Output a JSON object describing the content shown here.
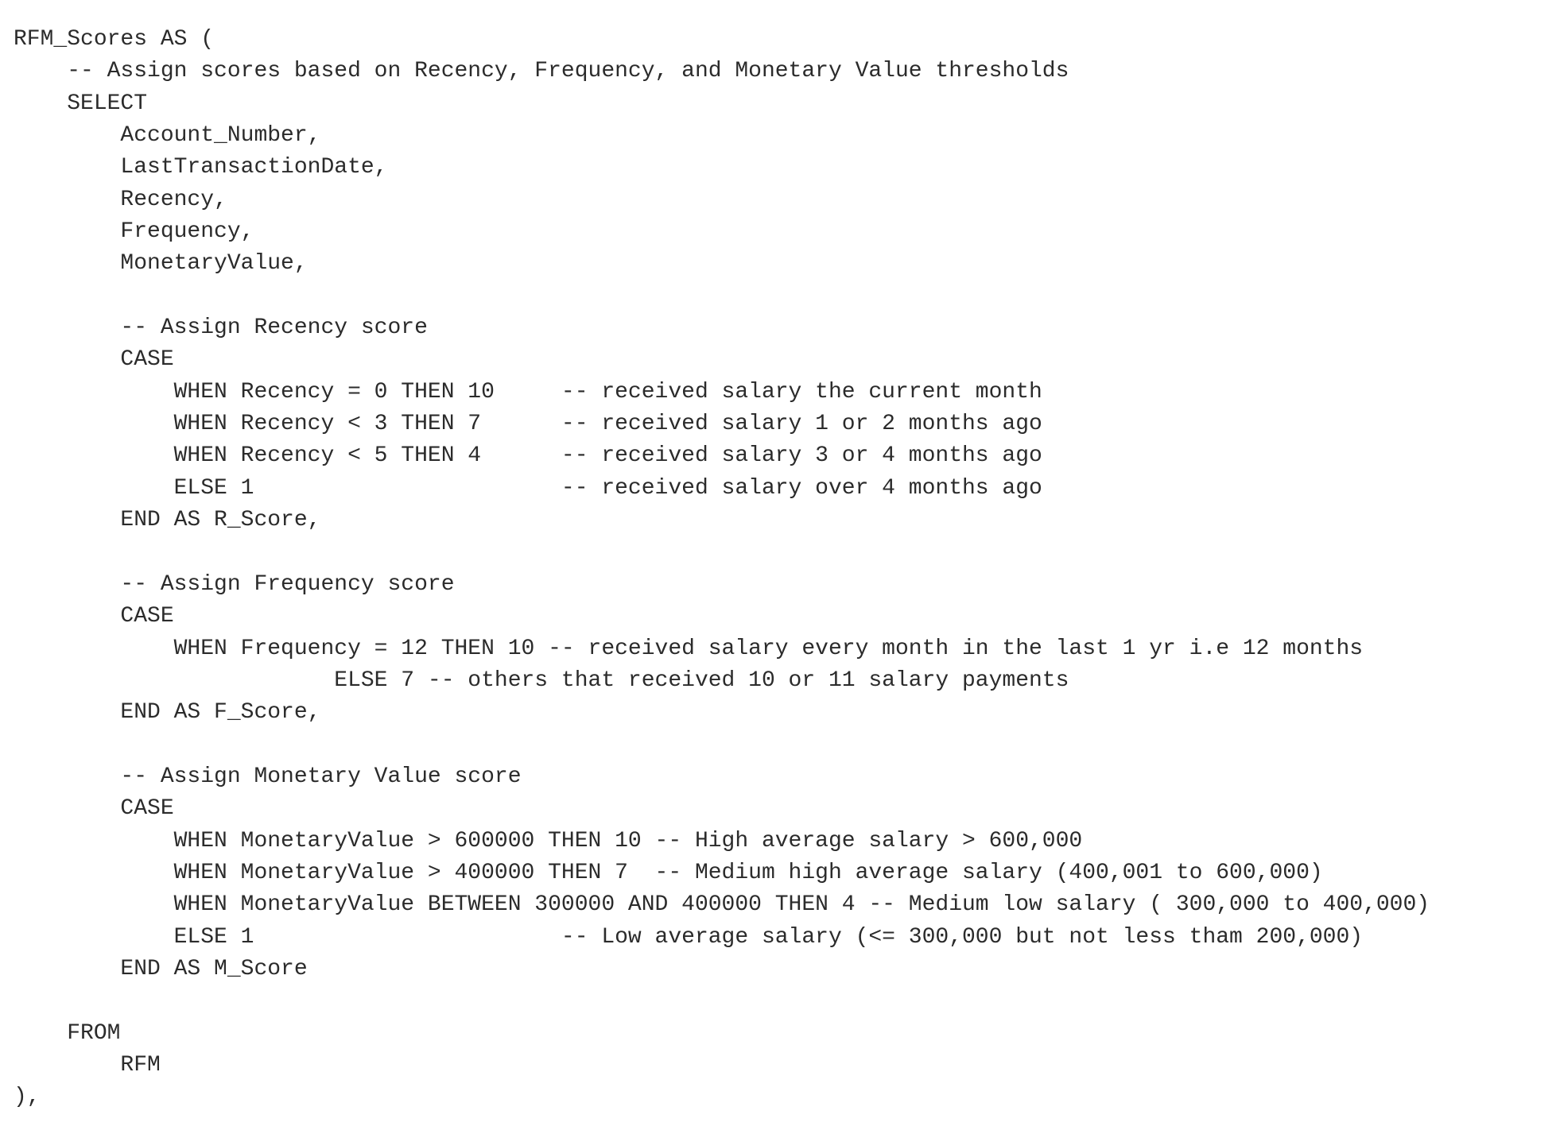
{
  "code": {
    "lines": [
      "RFM_Scores AS (",
      "    -- Assign scores based on Recency, Frequency, and Monetary Value thresholds",
      "    SELECT",
      "        Account_Number,",
      "        LastTransactionDate,",
      "        Recency,",
      "        Frequency,",
      "        MonetaryValue,",
      "",
      "        -- Assign Recency score",
      "        CASE",
      "            WHEN Recency = 0 THEN 10     -- received salary the current month",
      "            WHEN Recency < 3 THEN 7      -- received salary 1 or 2 months ago",
      "            WHEN Recency < 5 THEN 4      -- received salary 3 or 4 months ago",
      "            ELSE 1                       -- received salary over 4 months ago",
      "        END AS R_Score,",
      "",
      "        -- Assign Frequency score",
      "        CASE",
      "            WHEN Frequency = 12 THEN 10 -- received salary every month in the last 1 yr i.e 12 months",
      "                        ELSE 7 -- others that received 10 or 11 salary payments",
      "        END AS F_Score,",
      "",
      "        -- Assign Monetary Value score",
      "        CASE",
      "            WHEN MonetaryValue > 600000 THEN 10 -- High average salary > 600,000",
      "            WHEN MonetaryValue > 400000 THEN 7  -- Medium high average salary (400,001 to 600,000)",
      "            WHEN MonetaryValue BETWEEN 300000 AND 400000 THEN 4 -- Medium low salary ( 300,000 to 400,000)",
      "            ELSE 1                       -- Low average salary (<= 300,000 but not less tham 200,000)",
      "        END AS M_Score",
      "",
      "    FROM",
      "        RFM",
      "),"
    ]
  }
}
